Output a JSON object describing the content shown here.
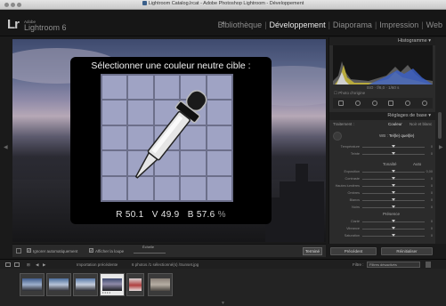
{
  "window": {
    "title": "Lightroom Catalog.lrcat - Adobe Photoshop Lightroom - Développement"
  },
  "identity": {
    "logo": "Lr",
    "brand_small": "Adobe",
    "brand_name": "Lightroom 6"
  },
  "modules": {
    "items": [
      "Bibliothèque",
      "Développement",
      "Diaporama",
      "Impression",
      "Web"
    ],
    "active_index": 1
  },
  "loupe": {
    "title": "Sélectionner une couleur neutre cible :",
    "r_label": "R",
    "r_value": "50.1",
    "v_label": "V",
    "v_value": "49.9",
    "b_label": "B",
    "b_value": "57.6",
    "unit": "%"
  },
  "right_panel": {
    "histogram_header": "Histogramme",
    "histogram_info": "ISO  ·  f/8,0  ·  1/60 s",
    "original_photo": "Photo d'origine",
    "basic_header": "Réglages de base",
    "tab_treatment": "Traitement :",
    "tab_color": "Couleur",
    "tab_bw": "Noir et blanc",
    "wb_label": "WB :",
    "wb_value": "Tel(le) quel(le)",
    "sliders_wb": [
      {
        "label": "Température",
        "value": "0"
      },
      {
        "label": "Teinte",
        "value": "0"
      }
    ],
    "tone_label": "Tonalité",
    "auto_label": "Auto",
    "sliders_tone": [
      {
        "label": "Exposition",
        "value": "0,00"
      },
      {
        "label": "Contraste",
        "value": "0"
      },
      {
        "label": "Hautes lumières",
        "value": "0"
      },
      {
        "label": "Ombres",
        "value": "0"
      },
      {
        "label": "Blancs",
        "value": "0"
      },
      {
        "label": "Noirs",
        "value": "0"
      }
    ],
    "presence_label": "Présence",
    "sliders_presence": [
      {
        "label": "Clarté",
        "value": "0"
      },
      {
        "label": "Vibrance",
        "value": "0"
      },
      {
        "label": "Saturation",
        "value": "0"
      }
    ],
    "btn_previous": "Précédent",
    "btn_reset": "Réinitialiser"
  },
  "toolbar": {
    "auto_dismiss": "Ignorer automatiquement",
    "show_loupe": "Afficher la loupe",
    "scale_label": "Échelle",
    "done": "Terminé"
  },
  "filmstrip": {
    "source": "Importation précédente",
    "count": "6 photos /1 sélectionné(s) /Sunset.jpg",
    "filter_label": "Filtre :",
    "filter_value": "Filtres désactivés"
  },
  "colors": {
    "grid_cell": "#9fa3c4",
    "active_module": "#e8e8e8"
  }
}
